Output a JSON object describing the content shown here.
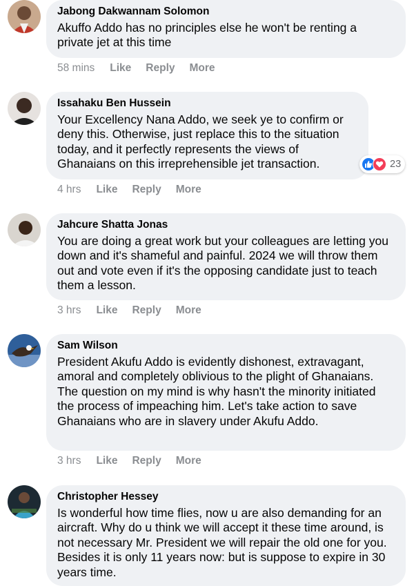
{
  "comments": [
    {
      "author": "Jabong Dakwannam Solomon",
      "text": "Akuffo Addo has no principles else he won't be renting a private jet at this time",
      "time": "58 mins",
      "like": "Like",
      "reply": "Reply",
      "more": "More"
    },
    {
      "author": "Issahaku Ben Hussein",
      "text": "Your Excellency Nana Addo, we seek ye to confirm or deny this. Otherwise, just replace this to the situation today, and it perfectly represents the views of Ghanaians on this irreprehensible jet transaction.",
      "time": "4 hrs",
      "like": "Like",
      "reply": "Reply",
      "more": "More",
      "reaction_count": "23",
      "reaction_icons": [
        "like-icon",
        "love-icon"
      ]
    },
    {
      "author": "Jahcure Shatta Jonas",
      "text": "You are doing a great work but your colleagues are letting you down and it's shameful and painful. 2024 we will throw them out and vote even if it's the opposing candidate just to teach them a lesson.",
      "time": "3 hrs",
      "like": "Like",
      "reply": "Reply",
      "more": "More"
    },
    {
      "author": "Sam Wilson",
      "text": "President Akufu Addo is evidently dishonest, extravagant, amoral and completely oblivious to the plight of Ghanaians. The question on my mind is why hasn't the minority initiated the process of impeaching him. Let's take action to save Ghanaians who are in slavery under Akufu Addo.",
      "time": "3 hrs",
      "like": "Like",
      "reply": "Reply",
      "more": "More"
    },
    {
      "author": "Christopher Hessey",
      "text": "Is wonderful how time flies, now u are also demanding for an aircraft. Why do u think we will accept it these time around, is not necessary Mr. President we will repair the old one for you. Besides it is only 11 years now: but is suppose to expire in 30 years time."
    }
  ],
  "colors": {
    "bubble": "#eff1f4",
    "meta_text": "#8a8d91",
    "like_blue": "#1877f2",
    "love_red": "#f33e58"
  }
}
